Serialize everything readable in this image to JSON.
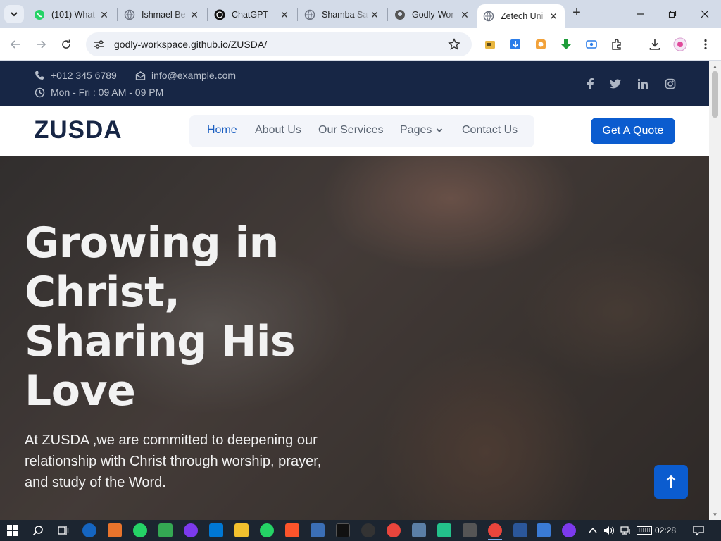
{
  "browser": {
    "tabs": [
      {
        "title": "(101) What",
        "icon": "whatsapp-icon"
      },
      {
        "title": "Ishmael Be",
        "icon": "globe-icon"
      },
      {
        "title": "ChatGPT",
        "icon": "chatgpt-icon"
      },
      {
        "title": "Shamba Sa",
        "icon": "globe-icon"
      },
      {
        "title": "Godly-Wor",
        "icon": "github-icon"
      },
      {
        "title": "Zetech Uni",
        "icon": "globe-icon",
        "active": true
      }
    ],
    "url": "godly-workspace.github.io/ZUSDA/",
    "new_tab": "+"
  },
  "site": {
    "topbar": {
      "phone": "+012 345 6789",
      "email": "info@example.com",
      "hours": "Mon - Fri : 09 AM - 09 PM",
      "social": [
        "f",
        "t",
        "in",
        "ig"
      ]
    },
    "logo": "ZUSDA",
    "nav": {
      "home": "Home",
      "about": "About Us",
      "services": "Our Services",
      "pages": "Pages",
      "contact": "Contact Us"
    },
    "cta": "Get A Quote",
    "hero": {
      "heading": "Growing in Christ, Sharing His Love",
      "text": "At ZUSDA ,we are committed to deepening our relationship with Christ through worship, prayer, and study of the Word."
    }
  },
  "taskbar": {
    "time": "02:28"
  },
  "colors": {
    "navy": "#172645",
    "accent": "#0b5ccf"
  }
}
